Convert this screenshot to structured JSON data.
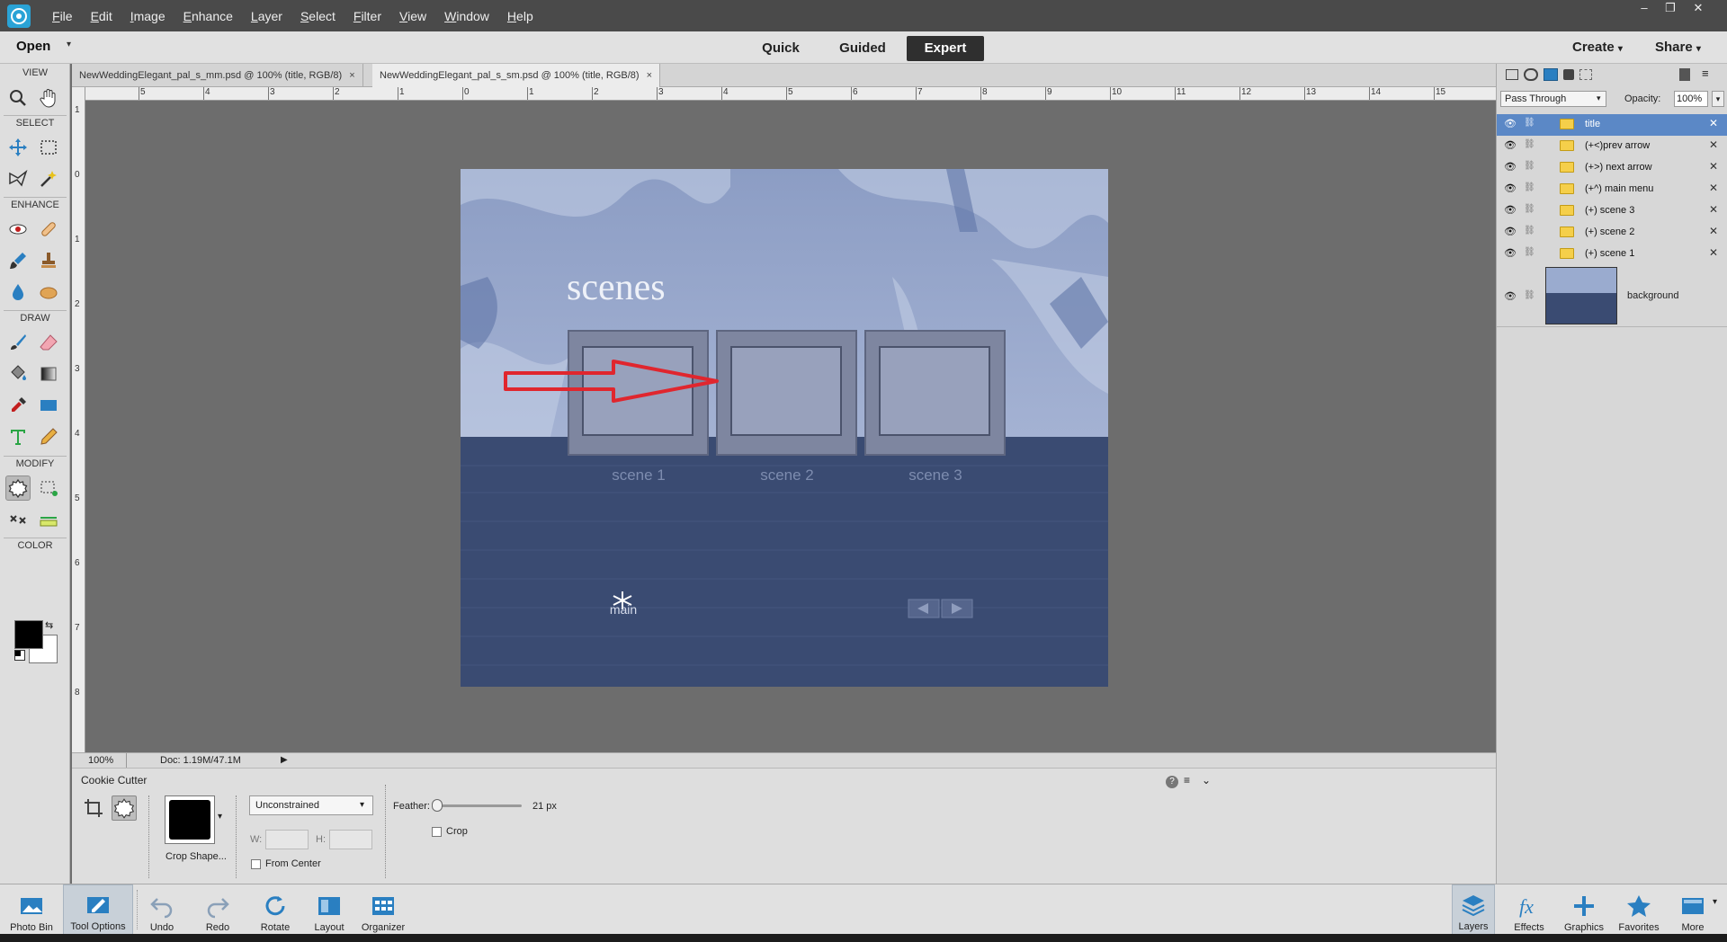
{
  "menubar": {
    "items": [
      "File",
      "Edit",
      "Image",
      "Enhance",
      "Layer",
      "Select",
      "Filter",
      "View",
      "Window",
      "Help"
    ],
    "window_buttons": [
      "–",
      "❐",
      "✕"
    ]
  },
  "modebar": {
    "open_label": "Open",
    "modes": [
      "Quick",
      "Guided",
      "Expert"
    ],
    "active_mode": "Expert",
    "create_label": "Create",
    "share_label": "Share"
  },
  "toolbox": {
    "sections": [
      "VIEW",
      "SELECT",
      "ENHANCE",
      "DRAW",
      "MODIFY",
      "COLOR"
    ],
    "foreground_color": "#000000",
    "background_color": "#ffffff"
  },
  "tabs": [
    {
      "title": "NewWeddingElegant_pal_s_mm.psd @ 100% (title, RGB/8)",
      "close": "×",
      "active": false
    },
    {
      "title": "NewWeddingElegant_pal_s_sm.psd @ 100% (title, RGB/8)",
      "close": "×",
      "active": true
    }
  ],
  "ruler": {
    "top_labels": [
      "5",
      "4",
      "3",
      "2",
      "1",
      "0",
      "1",
      "2",
      "3",
      "4",
      "5",
      "6",
      "7",
      "8",
      "9",
      "10",
      "11",
      "12",
      "13",
      "14",
      "15"
    ],
    "left_labels": [
      "1",
      "0",
      "1",
      "2",
      "3",
      "4",
      "5",
      "6",
      "7",
      "8"
    ]
  },
  "document": {
    "title_text": "scenes",
    "scene_labels": [
      "scene 1",
      "scene 2",
      "scene 3"
    ],
    "main_label": "main",
    "accent_color": "#e0262e"
  },
  "status": {
    "zoom": "100%",
    "doc_info": "Doc: 1.19M/47.1M"
  },
  "tool_options": {
    "tool_name": "Cookie Cutter",
    "crop_shape_label": "Crop Shape...",
    "constraint": "Unconstrained",
    "w_label": "W:",
    "h_label": "H:",
    "from_center_label": "From Center",
    "feather_label": "Feather:",
    "feather_value": "21 px",
    "feather_fraction": 0.03,
    "crop_label": "Crop"
  },
  "layers_panel": {
    "blend_mode": "Pass Through",
    "opacity_label": "Opacity:",
    "opacity_value": "100%",
    "layers": [
      {
        "name": "title",
        "type": "group",
        "selected": true
      },
      {
        "name": "(+<)prev arrow",
        "type": "group",
        "selected": false
      },
      {
        "name": "(+>) next arrow",
        "type": "group",
        "selected": false
      },
      {
        "name": "(+^) main menu",
        "type": "group",
        "selected": false
      },
      {
        "name": "(+) scene 3",
        "type": "group",
        "selected": false
      },
      {
        "name": "(+) scene 2",
        "type": "group",
        "selected": false
      },
      {
        "name": "(+) scene 1",
        "type": "group",
        "selected": false
      }
    ],
    "background_layer": "background"
  },
  "bottom_bar": {
    "left": [
      "Photo Bin",
      "Tool Options",
      "Undo",
      "Redo",
      "Rotate",
      "Layout",
      "Organizer"
    ],
    "right": [
      "Layers",
      "Effects",
      "Graphics",
      "Favorites",
      "More"
    ]
  },
  "icons": {
    "view": [
      "zoom-icon",
      "hand-icon"
    ],
    "select": [
      "move-icon",
      "marquee-icon",
      "lasso-icon",
      "magic-wand-icon"
    ],
    "enhance": [
      "red-eye-icon",
      "spot-healing-icon",
      "smart-brush-icon",
      "clone-stamp-icon",
      "blur-icon",
      "sponge-icon"
    ],
    "draw": [
      "brush-icon",
      "eraser-icon",
      "paint-bucket-icon",
      "gradient-icon",
      "eyedropper-icon",
      "shape-icon",
      "type-icon",
      "pencil-icon"
    ],
    "modify": [
      "cookie-cutter-icon",
      "crop-icon",
      "recompose-icon",
      "straighten-icon"
    ]
  }
}
